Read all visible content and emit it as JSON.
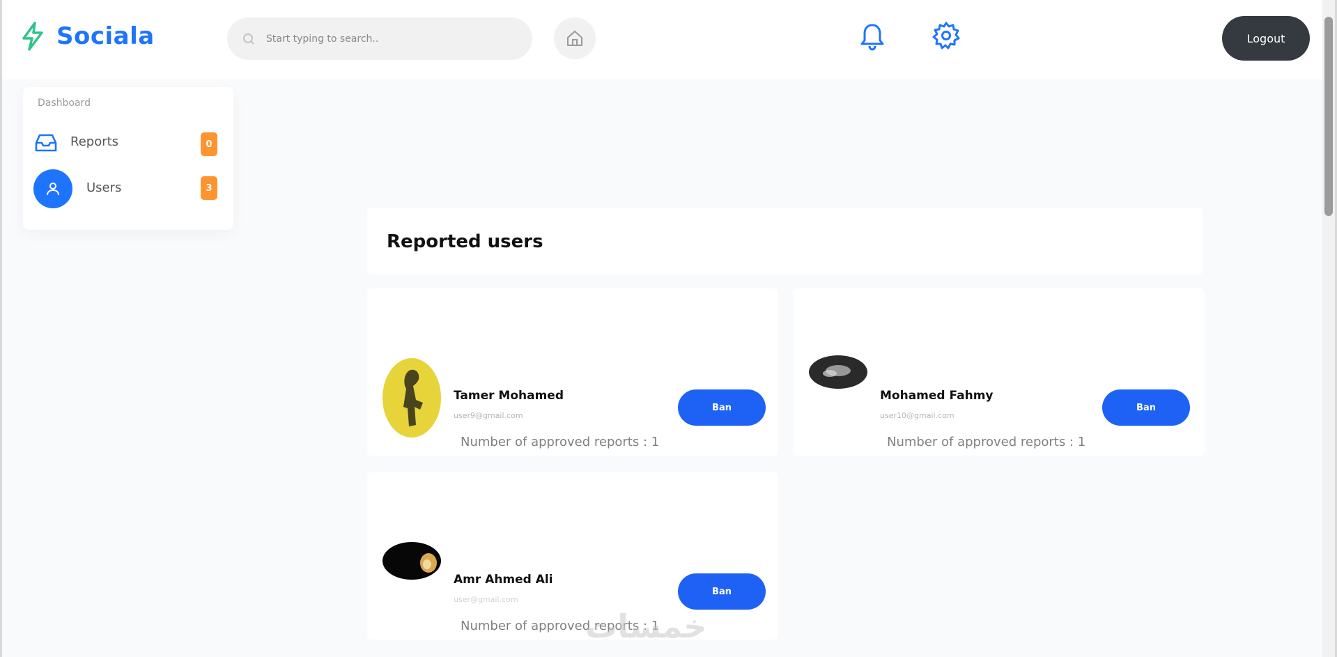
{
  "app": {
    "name": "Sociala",
    "brand_color": "#1e74fd",
    "accent_green": "#2fc38b"
  },
  "header": {
    "search_placeholder": "Start typing to search..",
    "icons": [
      "bolt-logo-icon",
      "search-icon",
      "home-icon",
      "bell-icon",
      "gear-icon"
    ],
    "logout_label": "Logout"
  },
  "sidebar": {
    "caption": "Dashboard",
    "items": [
      {
        "label": "Reports",
        "badge": "0",
        "icon": "inbox-icon",
        "active": false
      },
      {
        "label": "Users",
        "badge": "3",
        "icon": "user-icon",
        "active": true
      }
    ]
  },
  "main": {
    "title": "Reported users",
    "users": [
      {
        "name": "Tamer Mohamed",
        "email": "user9@gmail.com",
        "reports_text": "Number of approved reports : 1",
        "ban_label": "Ban"
      },
      {
        "name": "Mohamed Fahmy",
        "email": "user10@gmail.com",
        "reports_text": "Number of approved reports : 1",
        "ban_label": "Ban"
      },
      {
        "name": "Amr Ahmed Ali",
        "email": "user@gmail.com",
        "reports_text": "Number of approved reports : 1",
        "ban_label": "Ban"
      }
    ]
  },
  "watermark": "خمسات"
}
